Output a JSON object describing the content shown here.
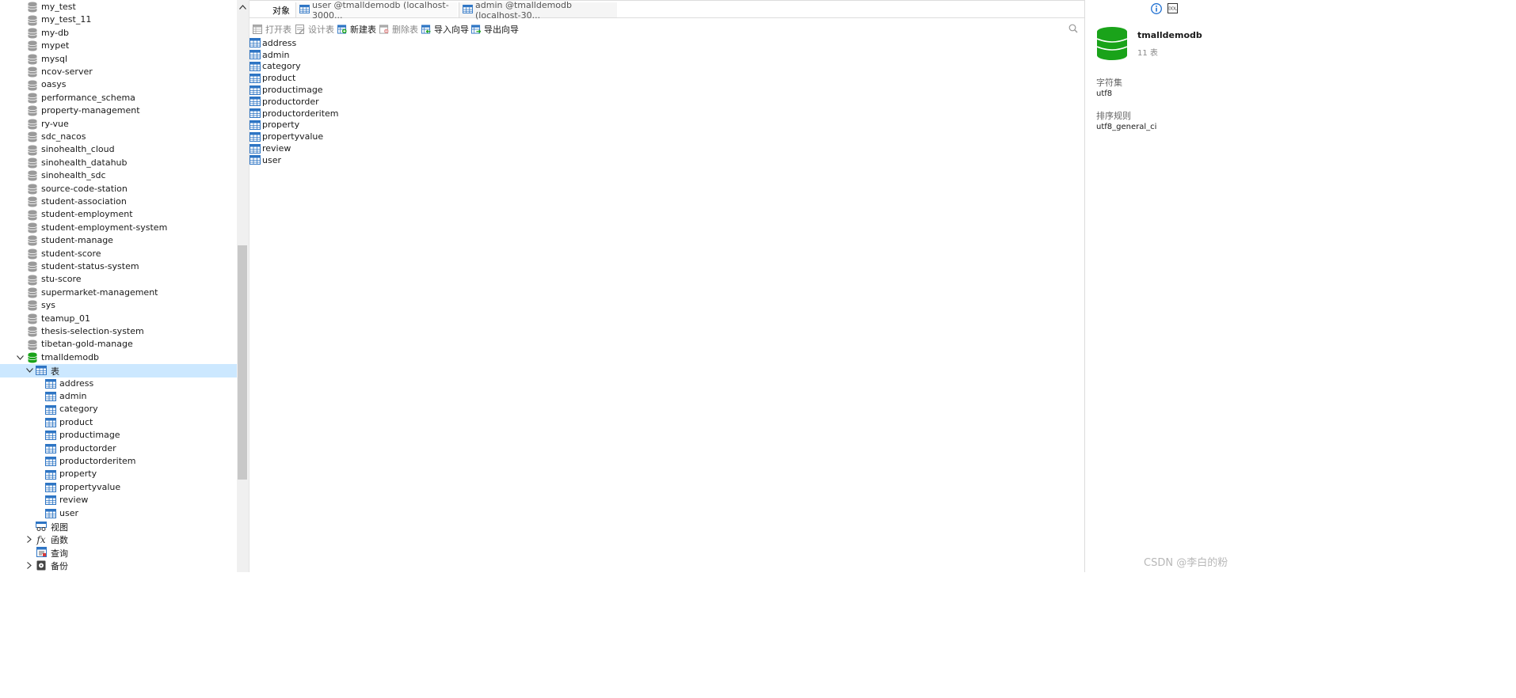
{
  "sidebar": {
    "databases": [
      "my_test",
      "my_test_11",
      "my-db",
      "mypet",
      "mysql",
      "ncov-server",
      "oasys",
      "performance_schema",
      "property-management",
      "ry-vue",
      "sdc_nacos",
      "sinohealth_cloud",
      "sinohealth_datahub",
      "sinohealth_sdc",
      "source-code-station",
      "student-association",
      "student-employment",
      "student-employment-system",
      "student-manage",
      "student-score",
      "student-status-system",
      "stu-score",
      "supermarket-management",
      "sys",
      "teamup_01",
      "thesis-selection-system",
      "tibetan-gold-manage"
    ],
    "open_database": "tmalldemodb",
    "tables_node": "表",
    "tables": [
      "address",
      "admin",
      "category",
      "product",
      "productimage",
      "productorder",
      "productorderitem",
      "property",
      "propertyvalue",
      "review",
      "user"
    ],
    "views_node": "视图",
    "functions_node": "函数",
    "queries_node": "查询",
    "backups_node": "备份"
  },
  "tabs": {
    "objects": "对象",
    "user_tab": "user @tmalldemodb (localhost-3000...",
    "admin_tab": "admin @tmalldemodb (localhost-30..."
  },
  "toolbar": {
    "open_table": "打开表",
    "design_table": "设计表",
    "new_table": "新建表",
    "delete_table": "删除表",
    "import_wizard": "导入向导",
    "export_wizard": "导出向导"
  },
  "table_list": [
    "address",
    "admin",
    "category",
    "product",
    "productimage",
    "productorder",
    "productorderitem",
    "property",
    "propertyvalue",
    "review",
    "user"
  ],
  "info_panel": {
    "db_name": "tmalldemodb",
    "table_count": "11 表",
    "charset_label": "字符集",
    "charset_value": "utf8",
    "collation_label": "排序规则",
    "collation_value": "utf8_general_ci",
    "ddl_icon_text": "DDL"
  },
  "watermark": "CSDN @李白的粉",
  "colors": {
    "db_green": "#1aa31a",
    "db_gray": "#9a9a9a",
    "table_blue": "#2e75c4",
    "selection": "#cce8ff"
  }
}
